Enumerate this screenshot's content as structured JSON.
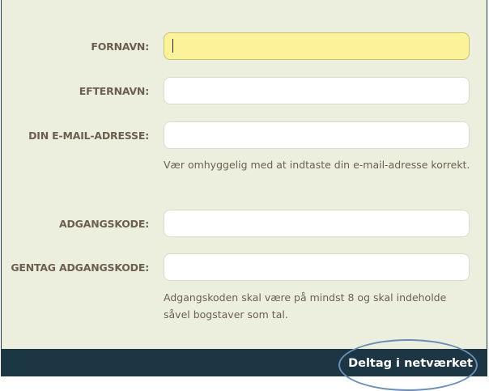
{
  "form": {
    "fields": [
      {
        "label": "FORNAVN:",
        "value": "",
        "placeholder": "",
        "focused": true
      },
      {
        "label": "EFTERNAVN:",
        "value": "",
        "placeholder": ""
      },
      {
        "label": "DIN E-MAIL-ADRESSE:",
        "value": "",
        "placeholder": ""
      },
      {
        "label": "ADGANGSKODE:",
        "value": "",
        "placeholder": ""
      },
      {
        "label": "GENTAG ADGANGSKODE:",
        "value": "",
        "placeholder": ""
      }
    ],
    "email_hint": "Vær omhyggelig med at indtaste din e-mail-adresse korrekt.",
    "password_hint": "Adgangskoden skal være på mindst 8 og skal indeholde såvel bogstaver som tal."
  },
  "footer": {
    "join_label": "Deltag i netværket"
  },
  "colors": {
    "background": "#ecefde",
    "label": "#6b5f52",
    "focused_field": "#fbf29a",
    "footer": "#1d3644",
    "highlight_ring": "#6a8fb8"
  }
}
